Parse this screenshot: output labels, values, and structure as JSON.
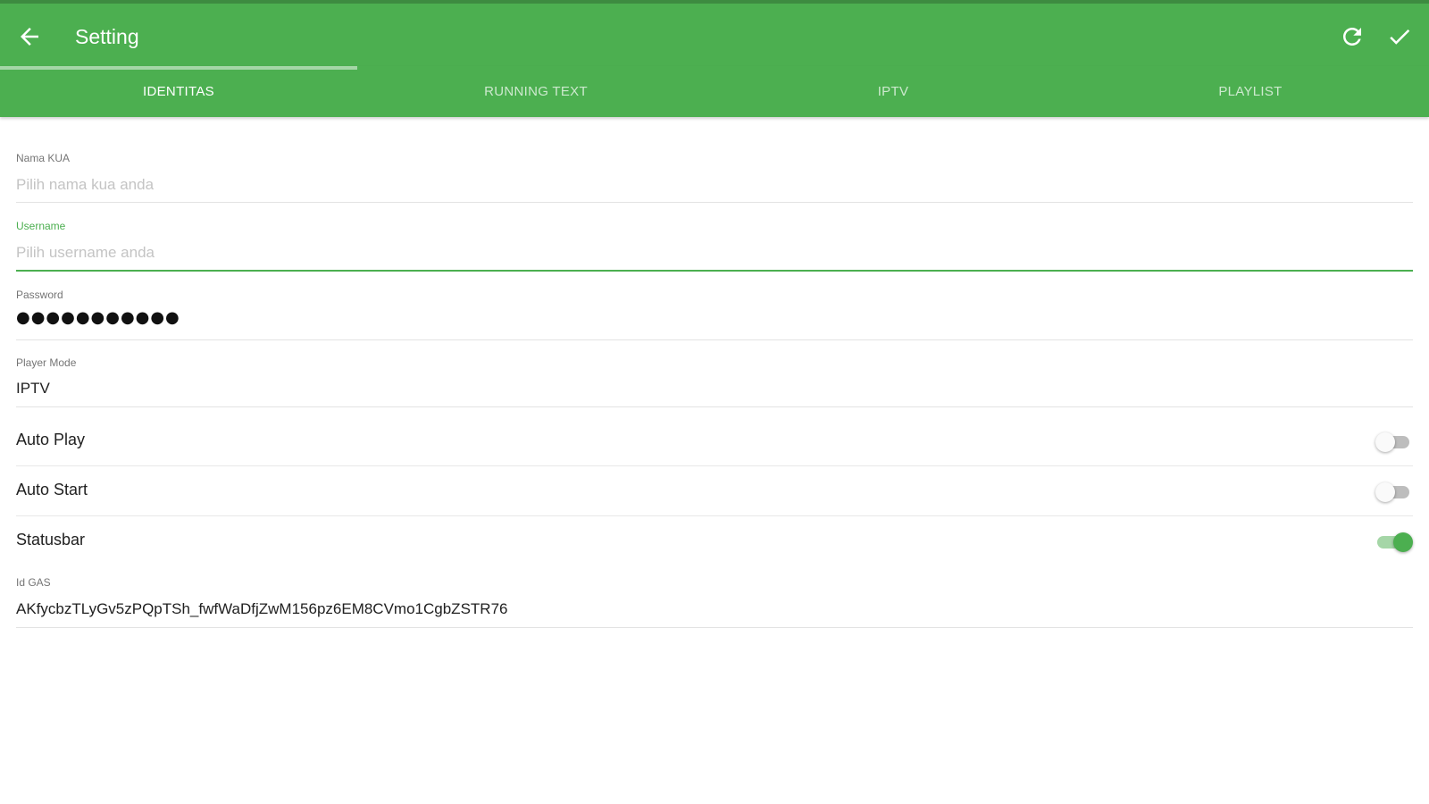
{
  "colors": {
    "primary": "#4caf50",
    "primary_dark": "#3d8b40",
    "accent_light": "#a5d6a7"
  },
  "toolbar": {
    "title": "Setting",
    "back_icon": "arrow-back-icon",
    "refresh_icon": "refresh-icon",
    "save_icon": "check-icon"
  },
  "tabs": [
    {
      "label": "IDENTITAS",
      "active": true
    },
    {
      "label": "RUNNING TEXT",
      "active": false
    },
    {
      "label": "IPTV",
      "active": false
    },
    {
      "label": "PLAYLIST",
      "active": false
    }
  ],
  "form": {
    "nama_kua": {
      "label": "Nama KUA",
      "value": "",
      "placeholder": "Pilih nama kua anda"
    },
    "username": {
      "label": "Username",
      "value": "",
      "placeholder": "Pilih username anda"
    },
    "password": {
      "label": "Password",
      "value": "●●●●●●●●●●●"
    },
    "player_mode": {
      "label": "Player Mode",
      "value": "IPTV"
    },
    "auto_play": {
      "label": "Auto Play",
      "on": false
    },
    "auto_start": {
      "label": "Auto Start",
      "on": false
    },
    "statusbar": {
      "label": "Statusbar",
      "on": true
    },
    "id_gas": {
      "label": "Id GAS",
      "value": "AKfycbzTLyGv5zPQpTSh_fwfWaDfjZwM156pz6EM8CVmo1CgbZSTR76"
    }
  }
}
